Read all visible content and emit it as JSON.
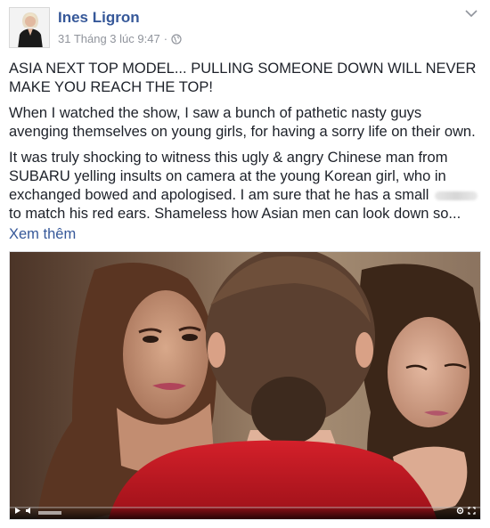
{
  "post": {
    "author": "Ines Ligron",
    "timestamp": "31 Tháng 3 lúc 9:47",
    "separator": "·",
    "privacy_icon": "globe-icon",
    "menu_icon": "chevron-down-icon",
    "paragraphs": {
      "p1": "ASIA NEXT TOP MODEL... PULLING SOMEONE DOWN WILL NEVER MAKE YOU REACH THE TOP!",
      "p2": "When I watched the show, I saw a bunch of pathetic nasty guys avenging themselves on young girls, for having a sorry life on their own.",
      "p3_before_blur": "It was truly shocking to witness this ugly & angry Chinese man from SUBARU yelling insults on camera at the young Korean girl, who in exchanged bowed and apologised. I am sure that he has a small",
      "p3_after_blur": "to match his red ears. Shameless how Asian men can look down so..."
    },
    "see_more": "Xem thêm"
  },
  "video": {
    "play_icon": "play-icon",
    "volume_icon": "volume-icon",
    "settings_icon": "settings-icon",
    "fullscreen_icon": "fullscreen-icon"
  }
}
